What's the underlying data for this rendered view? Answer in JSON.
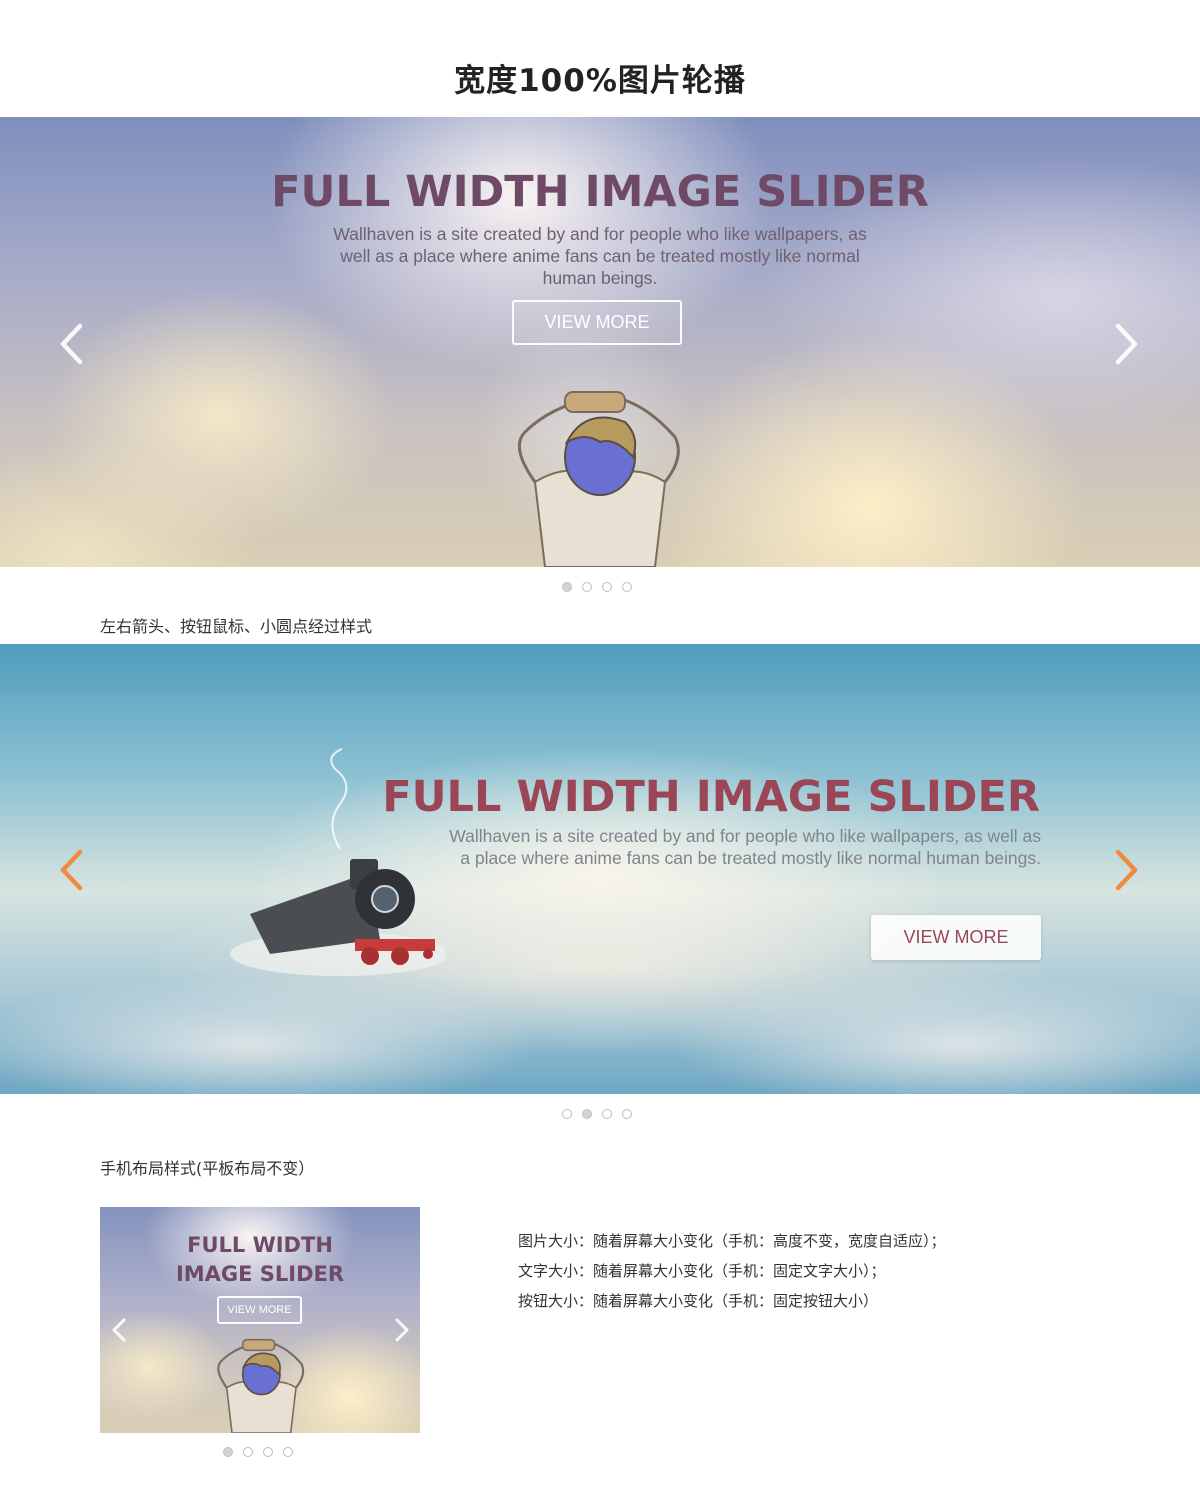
{
  "page": {
    "title": "宽度100%图片轮播"
  },
  "slider1": {
    "title": "FULL WIDTH IMAGE SLIDER",
    "description": "Wallhaven is a site created by and for people who like wallpapers, as well as a place where anime fans can be treated mostly like normal human beings.",
    "button_label": "VIEW MORE",
    "arrow_color": "#ffffff",
    "title_color": "#6e4a66",
    "dots": [
      {
        "active": true
      },
      {
        "active": false
      },
      {
        "active": false
      },
      {
        "active": false
      }
    ]
  },
  "section_hover_label": "左右箭头、按钮鼠标、小圆点经过样式",
  "slider2": {
    "title": "FULL WIDTH IMAGE SLIDER",
    "description": "Wallhaven is a site created by and for people who like wallpapers, as well as a place where anime fans can be treated mostly like normal human beings.",
    "button_label": "VIEW MORE",
    "arrow_color": "#f08a3c",
    "title_color": "#9a4657",
    "dots": [
      {
        "active": false
      },
      {
        "active": true
      },
      {
        "active": false
      },
      {
        "active": false
      }
    ]
  },
  "section_mobile_label": "手机布局样式(平板布局不变）",
  "mobile_preview": {
    "title_line1": "FULL WIDTH",
    "title_line2": "IMAGE SLIDER",
    "button_label": "VIEW MORE",
    "dots": [
      {
        "active": true
      },
      {
        "active": false
      },
      {
        "active": false
      },
      {
        "active": false
      }
    ]
  },
  "notes": [
    "图片大小：随着屏幕大小变化（手机：高度不变，宽度自适应）；",
    "文字大小：随着屏幕大小变化（手机：固定文字大小）；",
    "按钮大小：随着屏幕大小变化（手机：固定按钮大小）"
  ]
}
